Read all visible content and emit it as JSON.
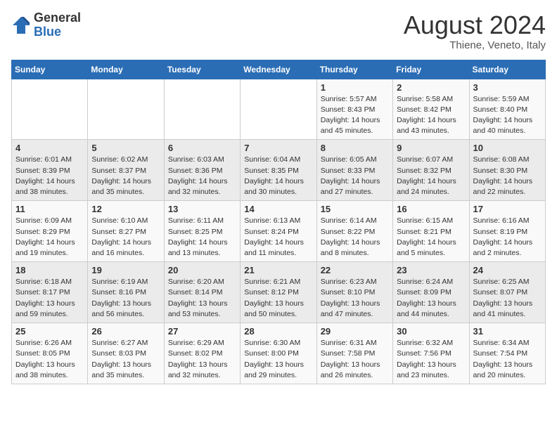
{
  "header": {
    "logo_general": "General",
    "logo_blue": "Blue",
    "month_year": "August 2024",
    "location": "Thiene, Veneto, Italy"
  },
  "days_of_week": [
    "Sunday",
    "Monday",
    "Tuesday",
    "Wednesday",
    "Thursday",
    "Friday",
    "Saturday"
  ],
  "weeks": [
    [
      {
        "day": "",
        "info": ""
      },
      {
        "day": "",
        "info": ""
      },
      {
        "day": "",
        "info": ""
      },
      {
        "day": "",
        "info": ""
      },
      {
        "day": "1",
        "info": "Sunrise: 5:57 AM\nSunset: 8:43 PM\nDaylight: 14 hours\nand 45 minutes."
      },
      {
        "day": "2",
        "info": "Sunrise: 5:58 AM\nSunset: 8:42 PM\nDaylight: 14 hours\nand 43 minutes."
      },
      {
        "day": "3",
        "info": "Sunrise: 5:59 AM\nSunset: 8:40 PM\nDaylight: 14 hours\nand 40 minutes."
      }
    ],
    [
      {
        "day": "4",
        "info": "Sunrise: 6:01 AM\nSunset: 8:39 PM\nDaylight: 14 hours\nand 38 minutes."
      },
      {
        "day": "5",
        "info": "Sunrise: 6:02 AM\nSunset: 8:37 PM\nDaylight: 14 hours\nand 35 minutes."
      },
      {
        "day": "6",
        "info": "Sunrise: 6:03 AM\nSunset: 8:36 PM\nDaylight: 14 hours\nand 32 minutes."
      },
      {
        "day": "7",
        "info": "Sunrise: 6:04 AM\nSunset: 8:35 PM\nDaylight: 14 hours\nand 30 minutes."
      },
      {
        "day": "8",
        "info": "Sunrise: 6:05 AM\nSunset: 8:33 PM\nDaylight: 14 hours\nand 27 minutes."
      },
      {
        "day": "9",
        "info": "Sunrise: 6:07 AM\nSunset: 8:32 PM\nDaylight: 14 hours\nand 24 minutes."
      },
      {
        "day": "10",
        "info": "Sunrise: 6:08 AM\nSunset: 8:30 PM\nDaylight: 14 hours\nand 22 minutes."
      }
    ],
    [
      {
        "day": "11",
        "info": "Sunrise: 6:09 AM\nSunset: 8:29 PM\nDaylight: 14 hours\nand 19 minutes."
      },
      {
        "day": "12",
        "info": "Sunrise: 6:10 AM\nSunset: 8:27 PM\nDaylight: 14 hours\nand 16 minutes."
      },
      {
        "day": "13",
        "info": "Sunrise: 6:11 AM\nSunset: 8:25 PM\nDaylight: 14 hours\nand 13 minutes."
      },
      {
        "day": "14",
        "info": "Sunrise: 6:13 AM\nSunset: 8:24 PM\nDaylight: 14 hours\nand 11 minutes."
      },
      {
        "day": "15",
        "info": "Sunrise: 6:14 AM\nSunset: 8:22 PM\nDaylight: 14 hours\nand 8 minutes."
      },
      {
        "day": "16",
        "info": "Sunrise: 6:15 AM\nSunset: 8:21 PM\nDaylight: 14 hours\nand 5 minutes."
      },
      {
        "day": "17",
        "info": "Sunrise: 6:16 AM\nSunset: 8:19 PM\nDaylight: 14 hours\nand 2 minutes."
      }
    ],
    [
      {
        "day": "18",
        "info": "Sunrise: 6:18 AM\nSunset: 8:17 PM\nDaylight: 13 hours\nand 59 minutes."
      },
      {
        "day": "19",
        "info": "Sunrise: 6:19 AM\nSunset: 8:16 PM\nDaylight: 13 hours\nand 56 minutes."
      },
      {
        "day": "20",
        "info": "Sunrise: 6:20 AM\nSunset: 8:14 PM\nDaylight: 13 hours\nand 53 minutes."
      },
      {
        "day": "21",
        "info": "Sunrise: 6:21 AM\nSunset: 8:12 PM\nDaylight: 13 hours\nand 50 minutes."
      },
      {
        "day": "22",
        "info": "Sunrise: 6:23 AM\nSunset: 8:10 PM\nDaylight: 13 hours\nand 47 minutes."
      },
      {
        "day": "23",
        "info": "Sunrise: 6:24 AM\nSunset: 8:09 PM\nDaylight: 13 hours\nand 44 minutes."
      },
      {
        "day": "24",
        "info": "Sunrise: 6:25 AM\nSunset: 8:07 PM\nDaylight: 13 hours\nand 41 minutes."
      }
    ],
    [
      {
        "day": "25",
        "info": "Sunrise: 6:26 AM\nSunset: 8:05 PM\nDaylight: 13 hours\nand 38 minutes."
      },
      {
        "day": "26",
        "info": "Sunrise: 6:27 AM\nSunset: 8:03 PM\nDaylight: 13 hours\nand 35 minutes."
      },
      {
        "day": "27",
        "info": "Sunrise: 6:29 AM\nSunset: 8:02 PM\nDaylight: 13 hours\nand 32 minutes."
      },
      {
        "day": "28",
        "info": "Sunrise: 6:30 AM\nSunset: 8:00 PM\nDaylight: 13 hours\nand 29 minutes."
      },
      {
        "day": "29",
        "info": "Sunrise: 6:31 AM\nSunset: 7:58 PM\nDaylight: 13 hours\nand 26 minutes."
      },
      {
        "day": "30",
        "info": "Sunrise: 6:32 AM\nSunset: 7:56 PM\nDaylight: 13 hours\nand 23 minutes."
      },
      {
        "day": "31",
        "info": "Sunrise: 6:34 AM\nSunset: 7:54 PM\nDaylight: 13 hours\nand 20 minutes."
      }
    ]
  ]
}
